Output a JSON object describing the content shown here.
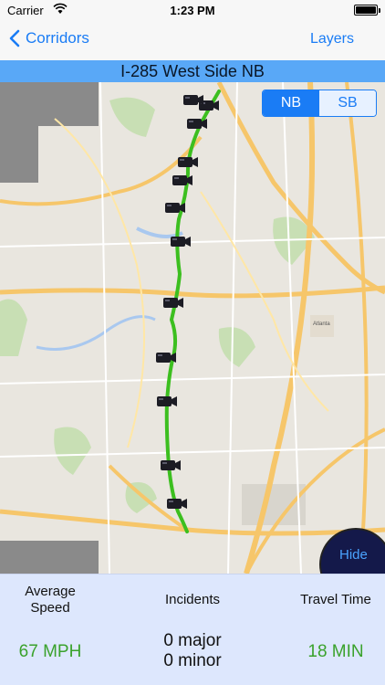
{
  "status_bar": {
    "carrier": "Carrier",
    "time": "1:23 PM",
    "wifi_icon": "wifi-icon",
    "battery_level": 1.0
  },
  "nav": {
    "back_label": "Corridors",
    "right_label": "Layers"
  },
  "corridor_title": "I-285 West Side NB",
  "direction_toggle": {
    "options": [
      "NB",
      "SB"
    ],
    "selected": "NB",
    "active_color": "#1a7cf5"
  },
  "map": {
    "city_label": "Atlanta",
    "route_color": "#3cbf1f",
    "camera_icon": "traffic-camera-icon",
    "camera_count": 12
  },
  "hide_button_label": "Hide",
  "stats": {
    "avg_speed_label": "Average Speed",
    "avg_speed_value": "67 MPH",
    "incidents_label": "Incidents",
    "incidents_major": "0 major",
    "incidents_minor": "0 minor",
    "travel_time_label": "Travel Time",
    "travel_time_value": "18 MIN",
    "value_color": "#3aa22c"
  }
}
